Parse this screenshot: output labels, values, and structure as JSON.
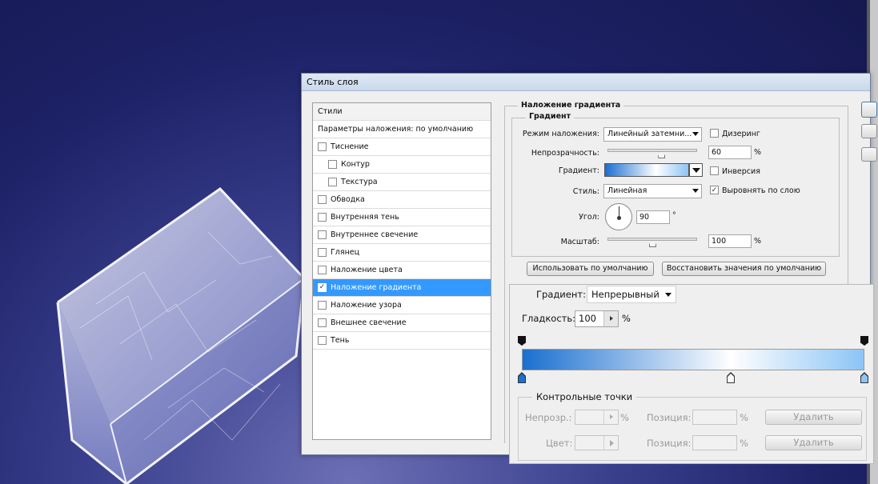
{
  "dialog": {
    "title": "Стиль слоя"
  },
  "styles_panel": {
    "header": "Стили",
    "blending_options": "Параметры наложения: по умолчанию",
    "items": [
      {
        "label": "Тиснение",
        "checked": false,
        "indent": false
      },
      {
        "label": "Контур",
        "checked": false,
        "indent": true
      },
      {
        "label": "Текстура",
        "checked": false,
        "indent": true
      },
      {
        "label": "Обводка",
        "checked": false,
        "indent": false
      },
      {
        "label": "Внутренняя тень",
        "checked": false,
        "indent": false
      },
      {
        "label": "Внутреннее свечение",
        "checked": false,
        "indent": false
      },
      {
        "label": "Глянец",
        "checked": false,
        "indent": false
      },
      {
        "label": "Наложение цвета",
        "checked": false,
        "indent": false
      },
      {
        "label": "Наложение градиента",
        "checked": true,
        "indent": false,
        "selected": true
      },
      {
        "label": "Наложение узора",
        "checked": false,
        "indent": false
      },
      {
        "label": "Внешнее свечение",
        "checked": false,
        "indent": false
      },
      {
        "label": "Тень",
        "checked": false,
        "indent": false
      }
    ]
  },
  "gradient_overlay": {
    "section_title": "Наложение градиента",
    "subsection_title": "Градиент",
    "blend_mode_label": "Режим наложения:",
    "blend_mode_value": "Линейный затемни...",
    "dither_label": "Дизеринг",
    "dither_checked": false,
    "opacity_label": "Непрозрачность:",
    "opacity_value": "60",
    "opacity_fraction": 0.6,
    "percent": "%",
    "gradient_label": "Градиент:",
    "reverse_label": "Инверсия",
    "reverse_checked": false,
    "style_label": "Стиль:",
    "style_value": "Линейная",
    "align_label": "Выровнять по слою",
    "align_checked": true,
    "angle_label": "Угол:",
    "angle_value": "90",
    "degree": "°",
    "scale_label": "Масштаб:",
    "scale_value": "100",
    "scale_fraction": 0.5,
    "make_default": "Использовать по умолчанию",
    "reset_default": "Восстановить значения по умолчанию"
  },
  "gradient_editor": {
    "type_label": "Градиент:",
    "type_value": "Непрерывный",
    "smoothness_label": "Гладкость:",
    "smoothness_value": "100",
    "percent": "%",
    "stops_group_title": "Контрольные точки",
    "opacity_label": "Непрозр.:",
    "location_label": "Позиция:",
    "color_label": "Цвет:",
    "delete_label": "Удалить",
    "color_stops": [
      {
        "location": 0,
        "color": "#1a6fd0"
      },
      {
        "location": 0.61,
        "color": "#ffffff"
      },
      {
        "location": 1,
        "color": "#8cc4f5"
      }
    ],
    "opacity_stops": [
      {
        "location": 0
      },
      {
        "location": 1
      }
    ]
  },
  "colors": {
    "gradient_start": "#1a6fd0",
    "gradient_mid": "#ffffff",
    "gradient_end": "#8cc4f5",
    "selection": "#3399ff"
  }
}
